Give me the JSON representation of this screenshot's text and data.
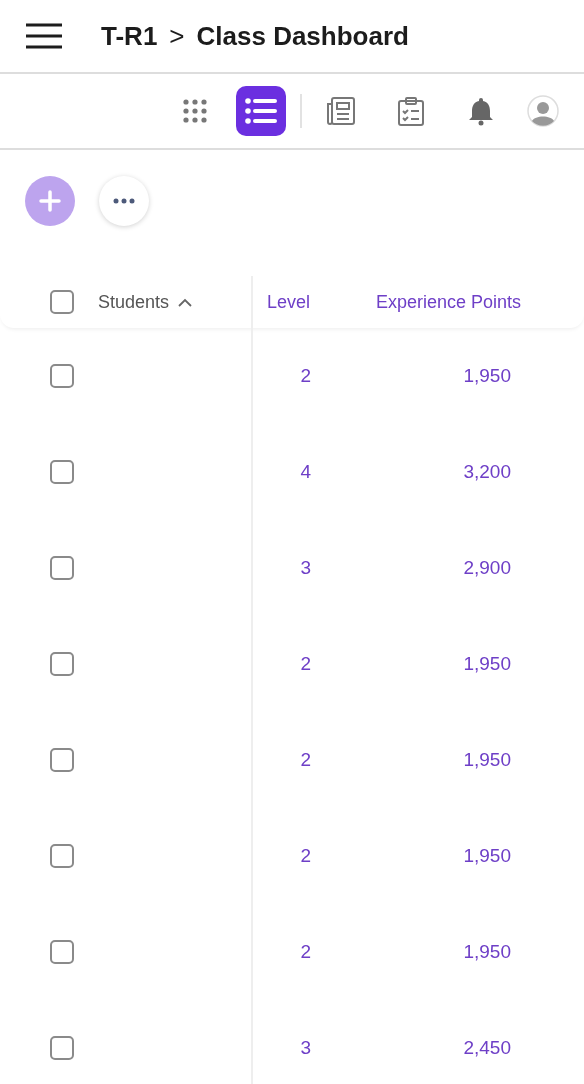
{
  "breadcrumb": {
    "parent": "T-R1",
    "separator": ">",
    "current": "Class Dashboard"
  },
  "view_toggle": [
    {
      "kind": "grid",
      "selected": false
    },
    {
      "kind": "list",
      "selected": true
    }
  ],
  "table": {
    "select_all": {
      "checked": false
    },
    "columns": [
      {
        "label": "Students",
        "sorted_ascending": true
      },
      {
        "label": "Level"
      },
      {
        "label": "Experience Points"
      }
    ],
    "rows": [
      {
        "checked": false,
        "level": "2",
        "xp": "1,950"
      },
      {
        "checked": false,
        "level": "4",
        "xp": "3,200"
      },
      {
        "checked": false,
        "level": "3",
        "xp": "2,900"
      },
      {
        "checked": false,
        "level": "2",
        "xp": "1,950"
      },
      {
        "checked": false,
        "level": "2",
        "xp": "1,950"
      },
      {
        "checked": false,
        "level": "2",
        "xp": "1,950"
      },
      {
        "checked": false,
        "level": "2",
        "xp": "1,950"
      },
      {
        "checked": false,
        "level": "3",
        "xp": "2,450"
      }
    ]
  }
}
